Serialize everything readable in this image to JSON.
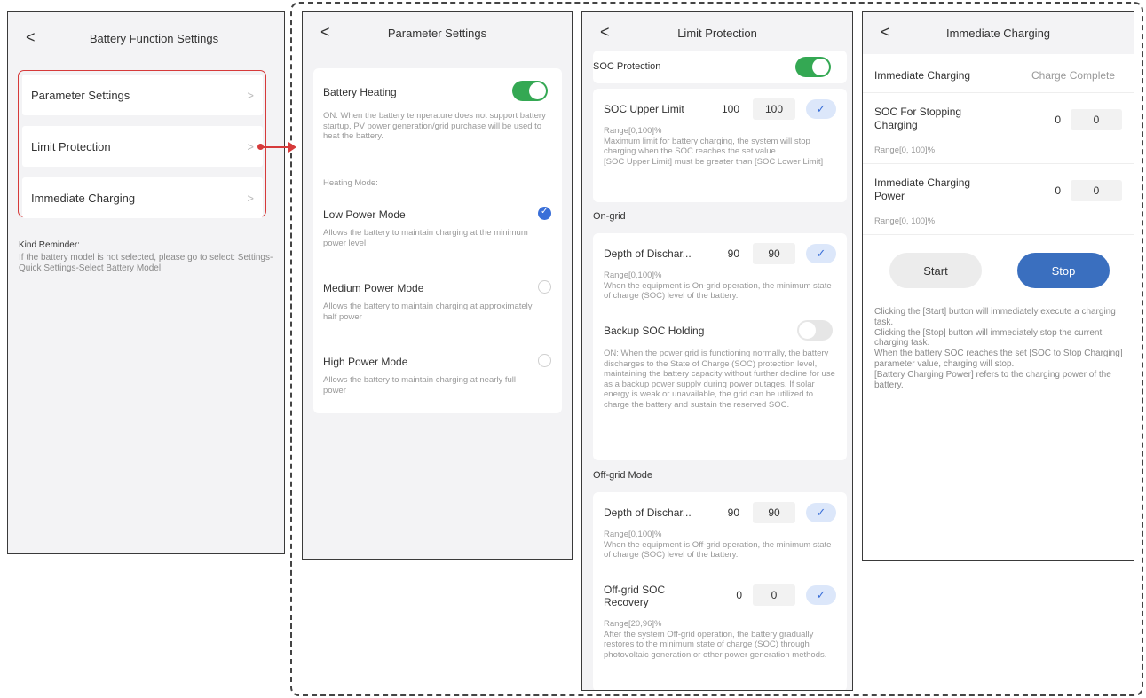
{
  "panel1": {
    "title": "Battery Function Settings",
    "back": "<",
    "items": [
      {
        "label": "Parameter Settings",
        "chevron": ">"
      },
      {
        "label": "Limit Protection",
        "chevron": ">"
      },
      {
        "label": "Immediate Charging",
        "chevron": ">"
      }
    ],
    "reminder_title": "Kind Reminder:",
    "reminder_text": "If the battery model is not selected, please go to select: Settings-Quick Settings-Select Battery Model"
  },
  "panel2": {
    "title": "Parameter Settings",
    "back": "<",
    "heating_label": "Battery Heating",
    "heating_on": true,
    "heating_desc": "ON: When the battery temperature does not support battery startup, PV power generation/grid purchase will be used to heat the battery.",
    "heating_mode_label": "Heating Mode:",
    "modes": [
      {
        "label": "Low Power Mode",
        "desc": "Allows the battery to maintain charging at the minimum power level",
        "selected": true
      },
      {
        "label": "Medium Power Mode",
        "desc": "Allows the battery to maintain charging at approximately half power",
        "selected": false
      },
      {
        "label": "High Power Mode",
        "desc": "Allows the battery to maintain charging at nearly full power",
        "selected": false
      }
    ]
  },
  "panel3": {
    "title": "Limit Protection",
    "back": "<",
    "soc_protection_label": "SOC Protection",
    "soc_protection_on": true,
    "soc_upper": {
      "label": "SOC Upper Limit",
      "value": "100",
      "input": "100",
      "desc": "Range[0,100]%\nMaximum limit for battery charging, the system will stop charging when the SOC reaches the set value.\n[SOC Upper Limit] must be greater than [SOC Lower Limit]"
    },
    "on_grid_label": "On-grid",
    "on_grid_dod": {
      "label": "Depth of Dischar...",
      "value": "90",
      "input": "90",
      "desc": "Range[0,100]%\nWhen the equipment is On-grid operation, the minimum state of charge (SOC) level of the battery."
    },
    "backup_label": "Backup SOC Holding",
    "backup_on": false,
    "backup_desc": "ON: When the power grid is functioning normally, the battery discharges to the State of Charge (SOC) protection level, maintaining the battery capacity without further decline for use as a backup power supply during power outages. If solar energy is weak or unavailable, the grid can be utilized to charge the battery and sustain the reserved SOC.",
    "off_grid_label": "Off-grid Mode",
    "off_grid_dod": {
      "label": "Depth of Dischar...",
      "value": "90",
      "input": "90",
      "desc": "Range[0,100]%\nWhen the equipment is Off-grid operation, the minimum state of charge (SOC) level of the battery."
    },
    "off_grid_recovery": {
      "label": "Off-grid SOC\nRecovery",
      "value": "0",
      "input": "0",
      "desc": "Range[20,96]%\nAfter the system Off-grid operation, the battery gradually restores to the minimum state of charge (SOC) through photovoltaic generation or other power generation methods."
    },
    "check": "✓"
  },
  "panel4": {
    "title": "Immediate Charging",
    "back": "<",
    "status_label": "Immediate Charging",
    "status_value": "Charge Complete",
    "stop_soc": {
      "label": "SOC For Stopping\nCharging",
      "value": "0",
      "input": "0",
      "range": "Range[0, 100]%"
    },
    "charge_power": {
      "label": "Immediate Charging\nPower",
      "value": "0",
      "input": "0",
      "range": "Range[0, 100]%"
    },
    "start_label": "Start",
    "stop_label": "Stop",
    "info": "Clicking the [Start] button will immediately execute a charging task.\nClicking the [Stop] button will immediately stop the current charging task.\nWhen the battery SOC reaches the set [SOC to Stop Charging] parameter value, charging will stop.\n[Battery Charging Power] refers to the charging power of the battery."
  },
  "colors": {
    "accent": "#3a6fbf",
    "toggle_on": "#34a853",
    "highlight": "#d63a3a"
  }
}
